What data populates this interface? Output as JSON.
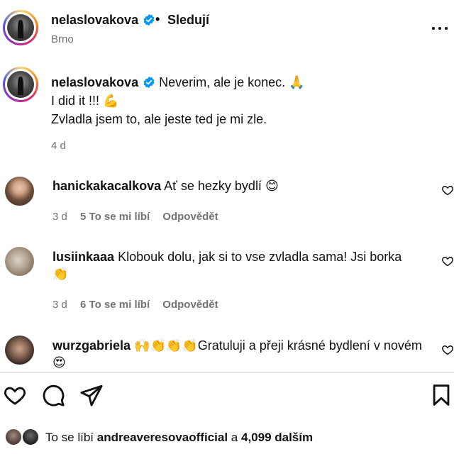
{
  "header": {
    "username": "nelaslovakova",
    "separator": "•",
    "follow_label": "Sledují",
    "location": "Brno"
  },
  "caption": {
    "username": "nelaslovakova",
    "line1": "Neverim, ale je konec.",
    "line1_emoji": "🙏",
    "line2": "I did it !!!",
    "line2_emoji": "💪",
    "line3": "Zvladla jsem to, ale jeste ted je mi zle.",
    "time": "4 d"
  },
  "comments": [
    {
      "username": "hanickakacalkova",
      "text": "Ať se hezky bydlí",
      "emoji": "😊",
      "time": "3 d",
      "likes": "5 To se mi líbí",
      "reply": "Odpovědět"
    },
    {
      "username": "lusiinkaaa",
      "text": "Klobouk dolu, jak si to vse zvladla sama! Jsi borka",
      "emoji": "👏",
      "time": "3 d",
      "likes": "6 To se mi líbí",
      "reply": "Odpovědět"
    },
    {
      "username": "wurzgabriela",
      "emoji_prefix": "🙌👏👏👏",
      "text": "Gratuluji a přeji krásné bydlení v novém",
      "emoji": "😍"
    }
  ],
  "likes_row": {
    "prefix": "To se líbí",
    "user": "andreaveresovaofficial",
    "middle": "a",
    "count": "4,099 dalším"
  },
  "icons": {
    "verified": "verified-badge-icon",
    "more": "more-options-icon",
    "like": "heart-icon",
    "comment": "comment-icon",
    "share": "send-icon",
    "save": "bookmark-icon"
  },
  "colors": {
    "verified_blue": "#0095f6",
    "secondary_text": "#737373",
    "primary_text": "#111111"
  }
}
